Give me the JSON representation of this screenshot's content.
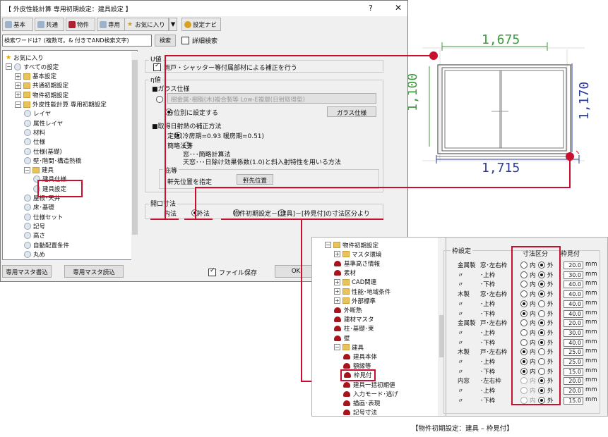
{
  "window": {
    "title": "【 外皮性能計算 専用初期設定：建具設定 】",
    "help": "?",
    "close": "✕"
  },
  "toolbar": [
    {
      "label": "基本",
      "icon": "disc-icon"
    },
    {
      "label": "共通",
      "icon": "disc-icon"
    },
    {
      "label": "物件",
      "icon": "house-icon"
    },
    {
      "label": "専用",
      "icon": "disc-icon"
    },
    {
      "label": "お気に入り",
      "icon": "star-icon"
    },
    {
      "label": "▼",
      "icon": ""
    },
    {
      "label": "設定ナビ",
      "icon": "gear-icon"
    }
  ],
  "search": {
    "value": "検索ワードは？(複数可。& 付きでAND検索文字)",
    "button": "検索",
    "detail_label": "詳細検索"
  },
  "tree": [
    {
      "label": "お気に入り",
      "indent": 0,
      "kind": "star",
      "pm": ""
    },
    {
      "label": "すべての設定",
      "indent": 0,
      "kind": "leaf",
      "pm": "−"
    },
    {
      "label": "基本設定",
      "indent": 1,
      "kind": "folder",
      "pm": "+"
    },
    {
      "label": "共通初期設定",
      "indent": 1,
      "kind": "folder",
      "pm": "+"
    },
    {
      "label": "物件初期設定",
      "indent": 1,
      "kind": "folder",
      "pm": "+"
    },
    {
      "label": "外皮性能計算 専用初期設定",
      "indent": 1,
      "kind": "folder",
      "pm": "−"
    },
    {
      "label": "レイヤ",
      "indent": 2,
      "kind": "leaf",
      "pm": ""
    },
    {
      "label": "属性レイヤ",
      "indent": 2,
      "kind": "leaf",
      "pm": ""
    },
    {
      "label": "材料",
      "indent": 2,
      "kind": "leaf",
      "pm": ""
    },
    {
      "label": "仕様",
      "indent": 2,
      "kind": "leaf",
      "pm": ""
    },
    {
      "label": "仕様(基礎)",
      "indent": 2,
      "kind": "leaf",
      "pm": ""
    },
    {
      "label": "壁･階間･構造熱橋",
      "indent": 2,
      "kind": "leaf",
      "pm": ""
    },
    {
      "label": "建具",
      "indent": 2,
      "kind": "folder",
      "pm": "−"
    },
    {
      "label": "建具仕様",
      "indent": 3,
      "kind": "leaf",
      "pm": ""
    },
    {
      "label": "建具設定",
      "indent": 3,
      "kind": "leaf",
      "pm": ""
    },
    {
      "label": "屋根･天井",
      "indent": 2,
      "kind": "leaf",
      "pm": ""
    },
    {
      "label": "床･基礎",
      "indent": 2,
      "kind": "leaf",
      "pm": ""
    },
    {
      "label": "仕様セット",
      "indent": 2,
      "kind": "leaf",
      "pm": ""
    },
    {
      "label": "記号",
      "indent": 2,
      "kind": "leaf",
      "pm": ""
    },
    {
      "label": "高さ",
      "indent": 2,
      "kind": "leaf",
      "pm": ""
    },
    {
      "label": "自動配置条件",
      "indent": 2,
      "kind": "leaf",
      "pm": ""
    },
    {
      "label": "丸め",
      "indent": 2,
      "kind": "leaf",
      "pm": ""
    }
  ],
  "panel": {
    "u_label": "U値",
    "u_check": "雨戸・シャッター等付属部材による補正を行う",
    "eta_label": "η値",
    "glass_head": "■ガラス仕様",
    "glass_combo": "樹金属･樹脂(木)複合製等 Low-E複層(日射取得型)",
    "glass_radio": "方位別に設定する",
    "glass_button": "ガラス仕様",
    "solar_head": "■取得日射熱の補正方法",
    "solar_opt1": "定数(冷房期=0.93 暖房期=0.51)",
    "solar_opt2": "簡略法等",
    "solar_line1": "窓･･･簡略計算法",
    "solar_line2": "天窓･･･日除け効果係数(1.0)と斜入射特性を用いる方法",
    "eaves_label": "庇等",
    "eaves_text": "軒先位置を指定",
    "eaves_button": "軒先位置",
    "opening_label": "開口寸法",
    "opening_opt1": "内法",
    "opening_opt2": "外法",
    "opening_opt3": "物件初期設定－[建具]－[枠見付]の寸法区分より"
  },
  "footer": {
    "btn1": "専用マスタ書込",
    "btn2": "専用マスタ読込",
    "save_label": "ファイル保存",
    "ok": "OK"
  },
  "figure": {
    "top": "1,675",
    "bottom": "1,715",
    "left": "1,100",
    "right": "1,170"
  },
  "dlg2": {
    "tree": [
      {
        "label": "物件初期設定",
        "indent": 0,
        "kind": "folder",
        "pm": "−"
      },
      {
        "label": "マスタ環境",
        "indent": 1,
        "kind": "folder",
        "pm": "+"
      },
      {
        "label": "基準高さ情報",
        "indent": 1,
        "kind": "hat",
        "pm": ""
      },
      {
        "label": "素材",
        "indent": 1,
        "kind": "hat",
        "pm": ""
      },
      {
        "label": "CAD関連",
        "indent": 1,
        "kind": "folder",
        "pm": "+"
      },
      {
        "label": "性能･地域条件",
        "indent": 1,
        "kind": "folder",
        "pm": "+"
      },
      {
        "label": "外部標準",
        "indent": 1,
        "kind": "folder",
        "pm": "+"
      },
      {
        "label": "外断熱",
        "indent": 1,
        "kind": "hat",
        "pm": ""
      },
      {
        "label": "建材マスタ",
        "indent": 1,
        "kind": "hat",
        "pm": ""
      },
      {
        "label": "柱･基礎･束",
        "indent": 1,
        "kind": "hat",
        "pm": ""
      },
      {
        "label": "壁",
        "indent": 1,
        "kind": "hat",
        "pm": ""
      },
      {
        "label": "建具",
        "indent": 1,
        "kind": "folder",
        "pm": "−"
      },
      {
        "label": "建具本体",
        "indent": 2,
        "kind": "hat",
        "pm": ""
      },
      {
        "label": "額縁等",
        "indent": 2,
        "kind": "hat",
        "pm": ""
      },
      {
        "label": "枠見付",
        "indent": 2,
        "kind": "hat",
        "pm": ""
      },
      {
        "label": "建具一括初期値",
        "indent": 2,
        "kind": "hat",
        "pm": ""
      },
      {
        "label": "入力モード･逃げ",
        "indent": 2,
        "kind": "hat",
        "pm": ""
      },
      {
        "label": "描画･表現",
        "indent": 2,
        "kind": "hat",
        "pm": ""
      },
      {
        "label": "記号寸法",
        "indent": 2,
        "kind": "hat",
        "pm": ""
      }
    ],
    "group_label": "枠設定",
    "col_dim": "寸法区分",
    "col_frame": "枠見付",
    "opt_in": "内",
    "opt_out": "外",
    "unit": "mm",
    "rows": [
      {
        "a": "金属製",
        "b": "窓･左右枠",
        "sel": "out",
        "val": "20.0",
        "dim": false
      },
      {
        "a": "〃",
        "b": "･上枠",
        "sel": "out",
        "val": "30.0",
        "dim": false
      },
      {
        "a": "〃",
        "b": "･下枠",
        "sel": "out",
        "val": "40.0",
        "dim": false
      },
      {
        "a": "木製",
        "b": "窓･左右枠",
        "sel": "out",
        "val": "40.0",
        "dim": false
      },
      {
        "a": "〃",
        "b": "･上枠",
        "sel": "in",
        "val": "40.0",
        "dim": false
      },
      {
        "a": "〃",
        "b": "･下枠",
        "sel": "in",
        "val": "40.0",
        "dim": false
      },
      {
        "a": "金属製",
        "b": "戸･左右枠",
        "sel": "out",
        "val": "20.0",
        "dim": false
      },
      {
        "a": "〃",
        "b": "･上枠",
        "sel": "out",
        "val": "30.0",
        "dim": false
      },
      {
        "a": "〃",
        "b": "･下枠",
        "sel": "out",
        "val": "40.0",
        "dim": false
      },
      {
        "a": "木製",
        "b": "戸･左右枠",
        "sel": "in",
        "val": "25.0",
        "dim": false
      },
      {
        "a": "〃",
        "b": "･上枠",
        "sel": "in",
        "val": "25.0",
        "dim": false
      },
      {
        "a": "〃",
        "b": "･下枠",
        "sel": "in",
        "val": "15.0",
        "dim": false
      },
      {
        "a": "内窓",
        "b": "･左右枠",
        "sel": "out",
        "val": "20.0",
        "dim": true
      },
      {
        "a": "〃",
        "b": "･上枠",
        "sel": "out",
        "val": "20.0",
        "dim": true
      },
      {
        "a": "〃",
        "b": "･下枠",
        "sel": "out",
        "val": "15.0",
        "dim": true
      }
    ],
    "caption": "【物件初期設定：建具 – 枠見付】"
  }
}
